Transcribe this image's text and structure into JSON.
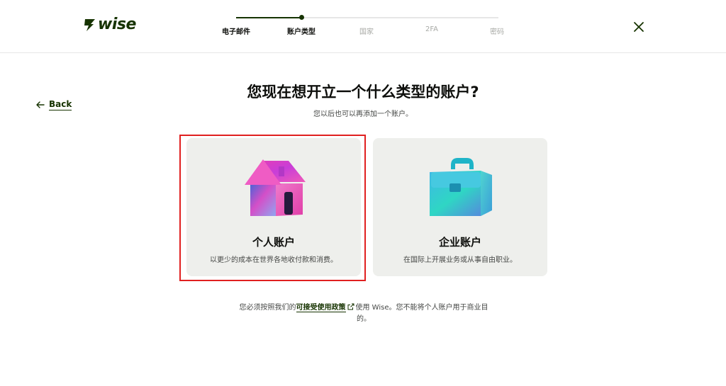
{
  "header": {
    "logo_text": "wise",
    "steps": [
      {
        "label": "电子邮件",
        "state": "done"
      },
      {
        "label": "账户类型",
        "state": "active"
      },
      {
        "label": "国家",
        "state": "todo"
      },
      {
        "label": "2FA",
        "state": "todo"
      },
      {
        "label": "密码",
        "state": "todo"
      }
    ],
    "close_icon": "close-icon"
  },
  "back": {
    "label": "Back",
    "icon": "arrow-left-icon"
  },
  "main": {
    "title": "您现在想开立一个什么类型的账户?",
    "subtitle": "您以后也可以再添加一个账户。",
    "cards": [
      {
        "title": "个人账户",
        "description": "以更少的成本在世界各地收付款和消费。",
        "icon": "house-icon",
        "selected": true
      },
      {
        "title": "企业账户",
        "description": "在国际上开展业务或从事自由职业。",
        "icon": "briefcase-icon",
        "selected": false
      }
    ]
  },
  "footer": {
    "prefix": "您必须按照我们的",
    "link": "可接受使用政策",
    "suffix": "使用 Wise。您不能将个人账户用于商业目的。"
  },
  "colors": {
    "brand": "#163300",
    "highlight": "#e02020",
    "card_bg": "#eeefec"
  }
}
